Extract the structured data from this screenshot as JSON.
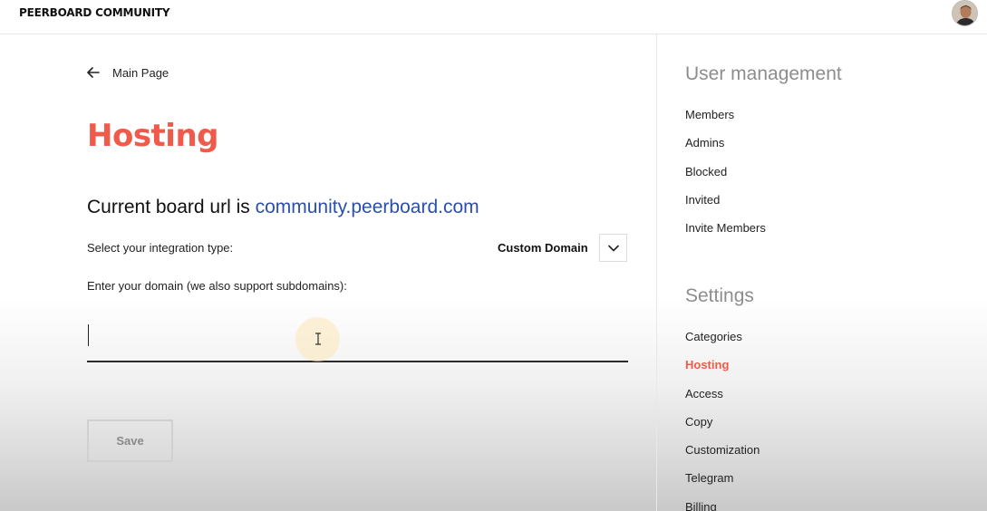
{
  "header": {
    "brand": "PEERBOARD COMMUNITY",
    "avatar_icon": "user-avatar"
  },
  "main": {
    "back_label": "Main Page",
    "title": "Hosting",
    "board_url_prefix": "Current board url is ",
    "board_url": "community.peerboard.com",
    "integration_label": "Select your integration type:",
    "integration_value": "Custom Domain",
    "domain_label": "Enter your domain (we also support subdomains):",
    "domain_value": "",
    "domain_placeholder": "",
    "save_label": "Save"
  },
  "sidebar": {
    "user_management_heading": "User management",
    "user_management_items": [
      "Members",
      "Admins",
      "Blocked",
      "Invited",
      "Invite Members"
    ],
    "settings_heading": "Settings",
    "settings_items": [
      "Categories",
      "Hosting",
      "Access",
      "Copy",
      "Customization",
      "Telegram",
      "Billing"
    ],
    "active_item": "Hosting"
  },
  "colors": {
    "accent": "#f05a4a",
    "link": "#2a4fb0",
    "muted_heading": "#8d8d8d"
  }
}
